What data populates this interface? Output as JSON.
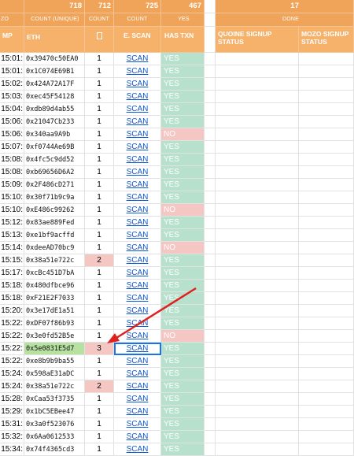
{
  "header_totals": {
    "count_unique": "718",
    "count": "712",
    "scan_count": "725",
    "yes_count": "467",
    "done_count": "17"
  },
  "header_labels": {
    "count_unique": "COUNT (UNIQUE)",
    "count": "COUNT",
    "scan_count": "COUNT",
    "yes": "YES",
    "done": "DONE",
    "ts_partial": "ZO"
  },
  "columns": {
    "timestamp": "MP",
    "eth": "ETH",
    "count_icon": "box-glyph",
    "escan": "E. SCAN",
    "has_txn": "HAS TXN",
    "quoine": "QUOINE SIGNUP STATUS",
    "mozo": "MOZO SIGNUP STATUS"
  },
  "colors": {
    "header_orange": "#f0a45a",
    "yes_green": "#b7e1cd",
    "no_red": "#f4c7c3",
    "link_blue": "#1155cc",
    "arrow_red": "#e0201e"
  },
  "rows": [
    {
      "ts": "15:01:",
      "eth": "0x39470c50EA0",
      "count": "1",
      "scan": "SCAN",
      "txn": "YES"
    },
    {
      "ts": "15:01:",
      "eth": "0x1C074E69B1",
      "count": "1",
      "scan": "SCAN",
      "txn": "YES"
    },
    {
      "ts": "15:02:",
      "eth": "0x424A72A17F",
      "count": "1",
      "scan": "SCAN",
      "txn": "YES"
    },
    {
      "ts": "15:03:",
      "eth": "0xec45F54128",
      "count": "1",
      "scan": "SCAN",
      "txn": "YES"
    },
    {
      "ts": "15:04:",
      "eth": "0xdb89d4ab55",
      "count": "1",
      "scan": "SCAN",
      "txn": "YES"
    },
    {
      "ts": "15:06:",
      "eth": "0x21047Cb233",
      "count": "1",
      "scan": "SCAN",
      "txn": "YES"
    },
    {
      "ts": "15:06:",
      "eth": "0x340aa9A9b",
      "count": "1",
      "scan": "SCAN",
      "txn": "NO"
    },
    {
      "ts": "15:07:",
      "eth": "0xf0744Ae69B",
      "count": "1",
      "scan": "SCAN",
      "txn": "YES"
    },
    {
      "ts": "15:08:",
      "eth": "0x4fc5c9dd52",
      "count": "1",
      "scan": "SCAN",
      "txn": "YES"
    },
    {
      "ts": "15:08:",
      "eth": "0xb69656D6A2",
      "count": "1",
      "scan": "SCAN",
      "txn": "YES"
    },
    {
      "ts": "15:09:",
      "eth": "0x2F486cD271",
      "count": "1",
      "scan": "SCAN",
      "txn": "YES"
    },
    {
      "ts": "15:10:",
      "eth": "0x30f71b9c9a",
      "count": "1",
      "scan": "SCAN",
      "txn": "YES"
    },
    {
      "ts": "15:10:",
      "eth": "0xE486c99262",
      "count": "1",
      "scan": "SCAN",
      "txn": "NO"
    },
    {
      "ts": "15:12:",
      "eth": "0x83ae889Fed",
      "count": "1",
      "scan": "SCAN",
      "txn": "YES"
    },
    {
      "ts": "15:13:",
      "eth": "0xe1bf9acffd",
      "count": "1",
      "scan": "SCAN",
      "txn": "YES"
    },
    {
      "ts": "15:14:",
      "eth": "0xdeeAD70bc9",
      "count": "1",
      "scan": "SCAN",
      "txn": "NO"
    },
    {
      "ts": "15:15:",
      "eth": "0x38a51e722c",
      "count": "2",
      "scan": "SCAN",
      "txn": "YES",
      "dup": true
    },
    {
      "ts": "15:17:",
      "eth": "0xcBc451D7bA",
      "count": "1",
      "scan": "SCAN",
      "txn": "YES"
    },
    {
      "ts": "15:18:",
      "eth": "0x480dfbce96",
      "count": "1",
      "scan": "SCAN",
      "txn": "YES"
    },
    {
      "ts": "15:18:",
      "eth": "0xF21E2F7033",
      "count": "1",
      "scan": "SCAN",
      "txn": "YES"
    },
    {
      "ts": "15:20:",
      "eth": "0x3e17dE1a51",
      "count": "1",
      "scan": "SCAN",
      "txn": "YES"
    },
    {
      "ts": "15:22:",
      "eth": "0xDF07f86b93",
      "count": "1",
      "scan": "SCAN",
      "txn": "YES"
    },
    {
      "ts": "15:22:",
      "eth": "0x3e0fd52B5e",
      "count": "1",
      "scan": "SCAN",
      "txn": "NO"
    },
    {
      "ts": "15:22:",
      "eth": "0x5e0831E5d7",
      "count": "3",
      "scan": "SCAN",
      "txn": "YES",
      "dup": true,
      "highlight": true
    },
    {
      "ts": "15:22:",
      "eth": "0xe8b9b9ba55",
      "count": "1",
      "scan": "SCAN",
      "txn": "YES"
    },
    {
      "ts": "15:24:",
      "eth": "0x598aE31aDC",
      "count": "1",
      "scan": "SCAN",
      "txn": "YES"
    },
    {
      "ts": "15:24:",
      "eth": "0x38a51e722c",
      "count": "2",
      "scan": "SCAN",
      "txn": "YES",
      "dup": true
    },
    {
      "ts": "15:28:",
      "eth": "0xCaa53f3735",
      "count": "1",
      "scan": "SCAN",
      "txn": "YES"
    },
    {
      "ts": "15:29:",
      "eth": "0x1bC5EBee47",
      "count": "1",
      "scan": "SCAN",
      "txn": "YES"
    },
    {
      "ts": "15:31:",
      "eth": "0x3a0f523076",
      "count": "1",
      "scan": "SCAN",
      "txn": "YES"
    },
    {
      "ts": "15:32:",
      "eth": "0x6Aa0612533",
      "count": "1",
      "scan": "SCAN",
      "txn": "YES"
    },
    {
      "ts": "15:34:",
      "eth": "0x74f4365cd3",
      "count": "1",
      "scan": "SCAN",
      "txn": "YES"
    }
  ]
}
